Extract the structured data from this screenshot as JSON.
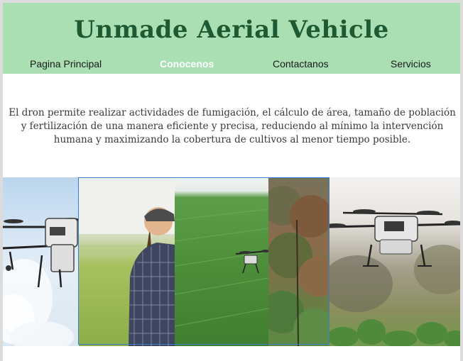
{
  "header": {
    "title": "Unmade Aerial Vehicle",
    "background_color": "#a9dfb2",
    "title_color": "#1d5a33"
  },
  "nav": {
    "items": [
      {
        "label": "Pagina Principal",
        "active": false
      },
      {
        "label": "Conocenos",
        "active": true
      },
      {
        "label": "Contactanos",
        "active": false
      },
      {
        "label": "Servicios",
        "active": false
      }
    ]
  },
  "intro": {
    "text": "El dron permite realizar actividades de fumigación, el cálculo de área, tamaño de población y fertilización de una manera eficiente y precisa, reduciendo al mínimo la intervención humana y maximizando la cobertura de cultivos al menor tiempo posible."
  },
  "gallery": {
    "images": [
      "spraying-drone-sky-image",
      "farmer-woman-field-image",
      "drone-over-green-field-image",
      "forest-trees-image",
      "agricultural-drone-crops-image"
    ]
  }
}
